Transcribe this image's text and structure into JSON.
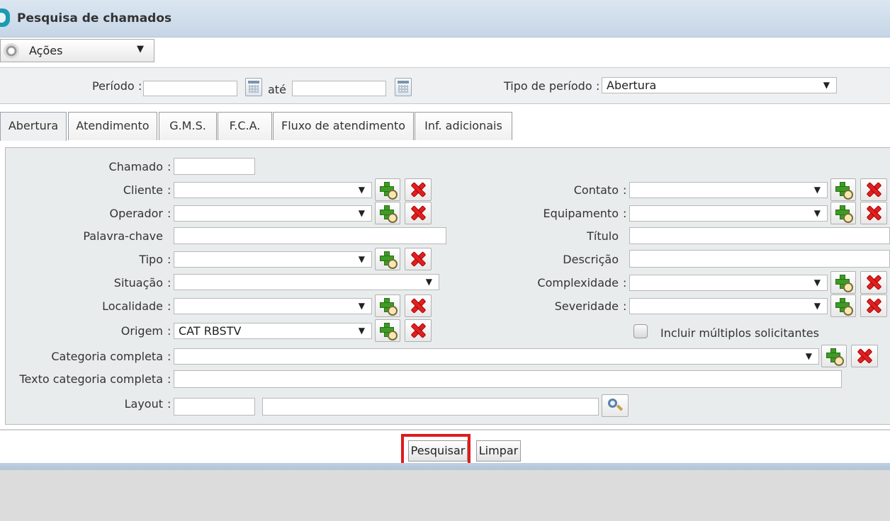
{
  "window": {
    "title": "Pesquisa de chamados"
  },
  "toolbar": {
    "actions_label": "Ações"
  },
  "period": {
    "label": "Período",
    "until": "até",
    "start": "",
    "end": "",
    "type_label": "Tipo de período",
    "type_value": "Abertura"
  },
  "tabs": [
    "Abertura",
    "Atendimento",
    "G.M.S.",
    "F.C.A.",
    "Fluxo de atendimento",
    "Inf. adicionais"
  ],
  "form": {
    "chamado": {
      "label": "Chamado",
      "value": ""
    },
    "cliente": {
      "label": "Cliente",
      "value": ""
    },
    "operador": {
      "label": "Operador",
      "value": ""
    },
    "palavra_chave": {
      "label": "Palavra-chave",
      "value": ""
    },
    "tipo": {
      "label": "Tipo",
      "value": ""
    },
    "situacao": {
      "label": "Situação",
      "value": ""
    },
    "localidade": {
      "label": "Localidade",
      "value": ""
    },
    "origem": {
      "label": "Origem",
      "value": "CAT RBSTV"
    },
    "categoria": {
      "label": "Categoria completa",
      "value": ""
    },
    "texto_categoria": {
      "label": "Texto categoria completa",
      "value": ""
    },
    "layout": {
      "label": "Layout",
      "code": "",
      "name": ""
    },
    "contato": {
      "label": "Contato",
      "value": ""
    },
    "equipamento": {
      "label": "Equipamento",
      "value": ""
    },
    "titulo": {
      "label": "Título",
      "value": ""
    },
    "descricao": {
      "label": "Descrição",
      "value": ""
    },
    "complexidade": {
      "label": "Complexidade",
      "value": ""
    },
    "severidade": {
      "label": "Severidade",
      "value": ""
    },
    "multiplos": {
      "label": "Incluir múltiplos solicitantes",
      "checked": false
    }
  },
  "separator": ":",
  "buttons": {
    "search": "Pesquisar",
    "clear": "Limpar"
  },
  "colors": {
    "highlight": "#e01b1b",
    "add": "#3c9c24",
    "remove": "#e02020"
  },
  "icons": [
    "gear-icon",
    "calendar-icon",
    "add-search-icon",
    "remove-icon",
    "magnifier-icon"
  ]
}
